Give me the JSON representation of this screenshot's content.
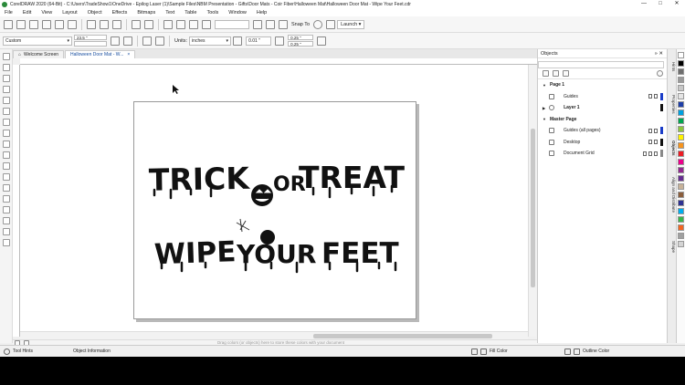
{
  "window": {
    "title": "CorelDRAW 2020 (64-Bit) - C:\\Users\\TradeShow1\\OneDrive - Epilog Laser (1)\\Sample Files\\NBM Presentation - Gifts\\Door Mats - Coir Fiber\\Halloween Mat\\Halloween Door Mat - Wipe Your Feet.cdr",
    "controls": {
      "minimize": "—",
      "maximize": "□",
      "close": "✕"
    }
  },
  "menu": [
    "File",
    "Edit",
    "View",
    "Layout",
    "Object",
    "Effects",
    "Bitmaps",
    "Text",
    "Table",
    "Tools",
    "Window",
    "Help"
  ],
  "toolbar": {
    "zoom_value": "",
    "snap_to": "Snap To",
    "launch": "Launch"
  },
  "property_bar": {
    "preset": "Custom",
    "width": "23.5 \"",
    "height": "",
    "units": "inches",
    "nudge": "0.01 \"",
    "dup_x": "0.25 \"",
    "dup_y": "0.25 \""
  },
  "tabs": [
    {
      "label": "Welcome Screen"
    },
    {
      "label": "Halloween Door Mat - W..."
    }
  ],
  "artwork": {
    "line1_left": "TRICK",
    "line1_mid": "OR",
    "line1_right": "TREAT",
    "line2_left": "WIPE",
    "line2_mid": "YOUR",
    "line2_right": "FEET"
  },
  "color_bar_hint": "Drag colors (or objects) here to store these colors with your document",
  "docker": {
    "title": "Objects",
    "tree": [
      {
        "type": "group",
        "label": "Page 1"
      },
      {
        "type": "item",
        "label": "Guides",
        "icon": "guides-icon",
        "color": "#1a3cc8"
      },
      {
        "type": "layer",
        "label": "Layer 1",
        "icon": "layer-icon",
        "color": "#111111"
      },
      {
        "type": "group",
        "label": "Master Page"
      },
      {
        "type": "item",
        "label": "Guides (all pages)",
        "icon": "guides-icon",
        "color": "#1a3cc8"
      },
      {
        "type": "item",
        "label": "Desktop",
        "icon": "desktop-icon",
        "color": "#111111"
      },
      {
        "type": "item",
        "label": "Document Grid",
        "icon": "grid-icon",
        "color": "#888888"
      }
    ]
  },
  "side_tabs": [
    "Hints",
    "Properties",
    "Objects",
    "Align and Distribute",
    "Shape"
  ],
  "palette": [
    "#ffffff",
    "#000000",
    "#6e6e6e",
    "#9a9a9a",
    "#c8c8c8",
    "#e5e5e5",
    "#1e3fa8",
    "#00a0e0",
    "#00a651",
    "#8dc63f",
    "#fff200",
    "#f7941d",
    "#ed1c24",
    "#ec008c",
    "#92278f",
    "#662d91",
    "#c7b299",
    "#8b5e3c",
    "#2e3192",
    "#00aeef",
    "#39b54a",
    "#f26522",
    "#a0a0a0",
    "#d4d4d4"
  ],
  "status": {
    "tool_hints": "Tool Hints",
    "object_info": "Object Information",
    "fill": "Fill Color",
    "outline": "Outline Color"
  }
}
